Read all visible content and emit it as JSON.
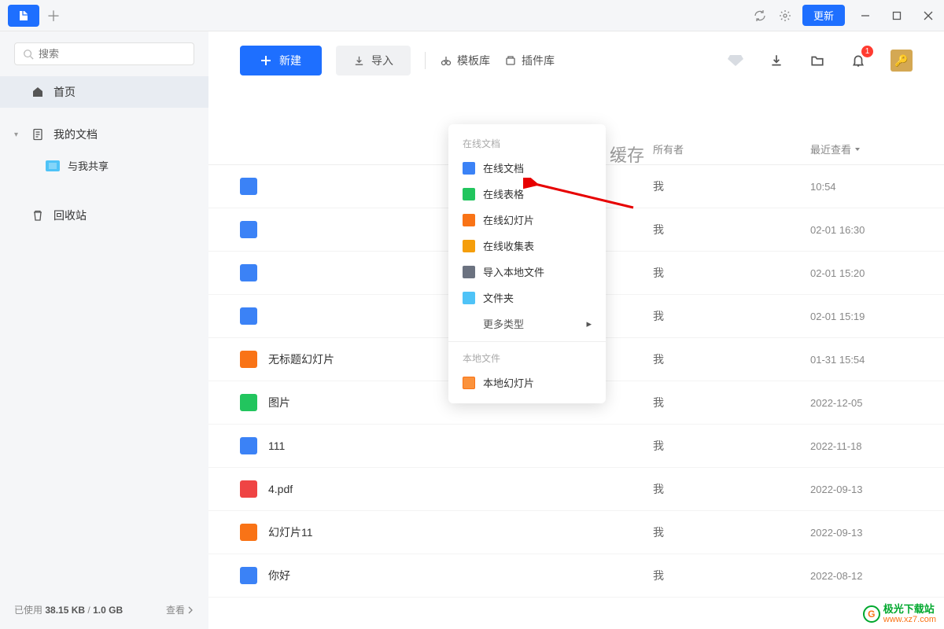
{
  "titlebar": {
    "update_label": "更新",
    "notification_count": "1"
  },
  "sidebar": {
    "search_placeholder": "搜索",
    "nav": {
      "home": "首页",
      "mydocs": "我的文档",
      "shared": "与我共享",
      "trash": "回收站"
    },
    "storage": {
      "label": "已使用",
      "used": "38.15 KB",
      "sep": "/",
      "total": "1.0 GB",
      "view": "查看"
    }
  },
  "toolbar": {
    "new_label": "新建",
    "import_label": "导入",
    "templates": "模板库",
    "plugins": "插件库"
  },
  "faded_header": "缓存",
  "table": {
    "col_owner": "所有者",
    "col_time": "最近查看"
  },
  "dropdown": {
    "section_online": "在线文档",
    "items_online": [
      {
        "label": "在线文档",
        "cls": "ico-doc"
      },
      {
        "label": "在线表格",
        "cls": "ico-sheet"
      },
      {
        "label": "在线幻灯片",
        "cls": "ico-slide"
      },
      {
        "label": "在线收集表",
        "cls": "ico-form"
      },
      {
        "label": "导入本地文件",
        "cls": "ico-local"
      },
      {
        "label": "文件夹",
        "cls": "ico-folder"
      }
    ],
    "more": "更多类型",
    "section_local": "本地文件",
    "items_local": [
      {
        "label": "本地幻灯片",
        "cls": "ico-pslide"
      }
    ]
  },
  "files": [
    {
      "name": "",
      "owner": "我",
      "time": "10:54",
      "cls": "ico-doc"
    },
    {
      "name": "",
      "owner": "我",
      "time": "02-01 16:30",
      "cls": "ico-doc"
    },
    {
      "name": "",
      "owner": "我",
      "time": "02-01 15:20",
      "cls": "ico-doc"
    },
    {
      "name": "",
      "owner": "我",
      "time": "02-01 15:19",
      "cls": "ico-doc"
    },
    {
      "name": "无标题幻灯片",
      "owner": "我",
      "time": "01-31 15:54",
      "cls": "ico-slide"
    },
    {
      "name": "图片",
      "owner": "我",
      "time": "2022-12-05",
      "cls": "ico-sheet"
    },
    {
      "name": "111",
      "owner": "我",
      "time": "2022-11-18",
      "cls": "ico-doc"
    },
    {
      "name": "4.pdf",
      "owner": "我",
      "time": "2022-09-13",
      "cls": "ico-pdf"
    },
    {
      "name": "幻灯片11",
      "owner": "我",
      "time": "2022-09-13",
      "cls": "ico-slide"
    },
    {
      "name": "你好",
      "owner": "我",
      "time": "2022-08-12",
      "cls": "ico-doc"
    }
  ],
  "watermark": {
    "text1": "极光下载站",
    "text2": "www.xz7.com"
  }
}
